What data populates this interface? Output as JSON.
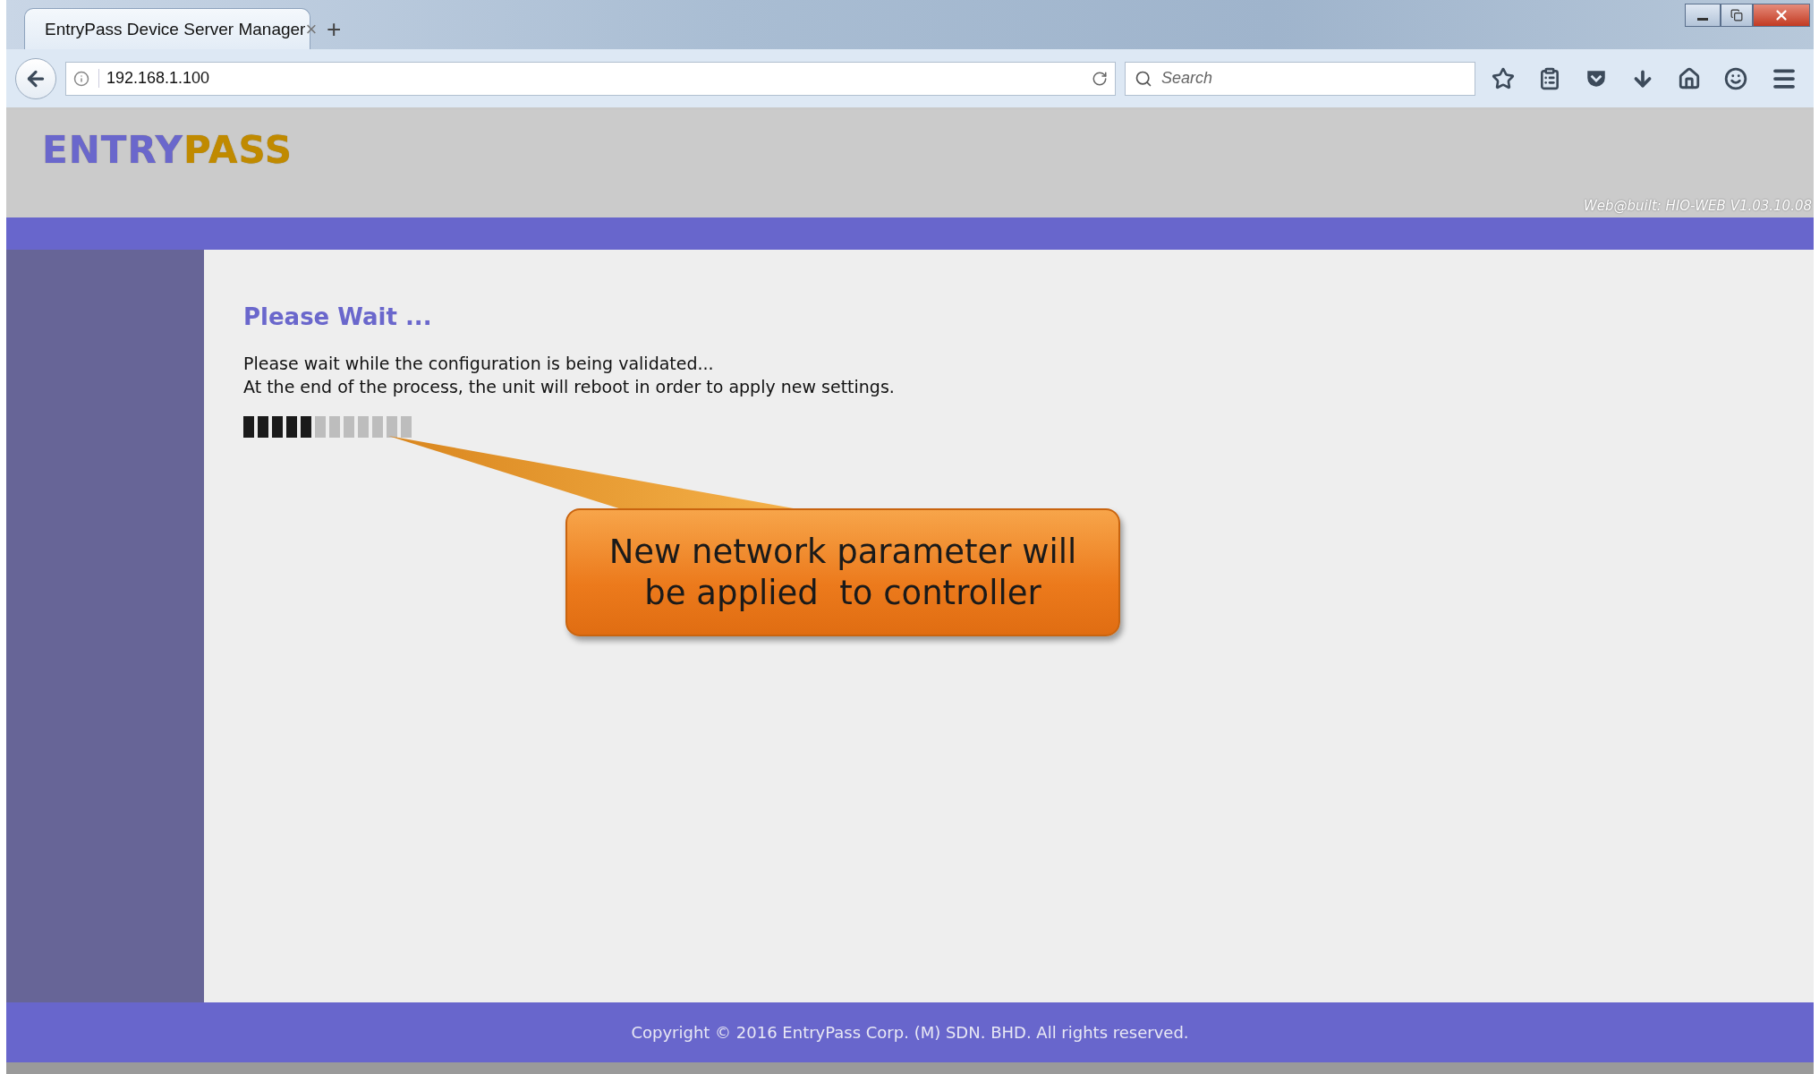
{
  "browser": {
    "tab": {
      "title": "EntryPass Device Server Manager",
      "close": "×"
    },
    "new_tab": "+",
    "address": "192.168.1.100",
    "search": {
      "placeholder": "Search"
    }
  },
  "header": {
    "logo": {
      "first": "ENTRY",
      "second": "PASS"
    },
    "version": "Web@built: HIO-WEB V1.03.10.08"
  },
  "content": {
    "title": "Please Wait ...",
    "lines": [
      "Please wait while the configuration is being validated...",
      "At the end of the process, the unit will reboot in order to apply new settings."
    ],
    "progress": {
      "level": 0.4167
    }
  },
  "callout": {
    "lines": [
      "New network parameter will",
      "be applied  to controller"
    ]
  },
  "footer": {
    "text": "Copyright © 2016 EntryPass Corp. (M) SDN. BHD. All rights reserved."
  }
}
